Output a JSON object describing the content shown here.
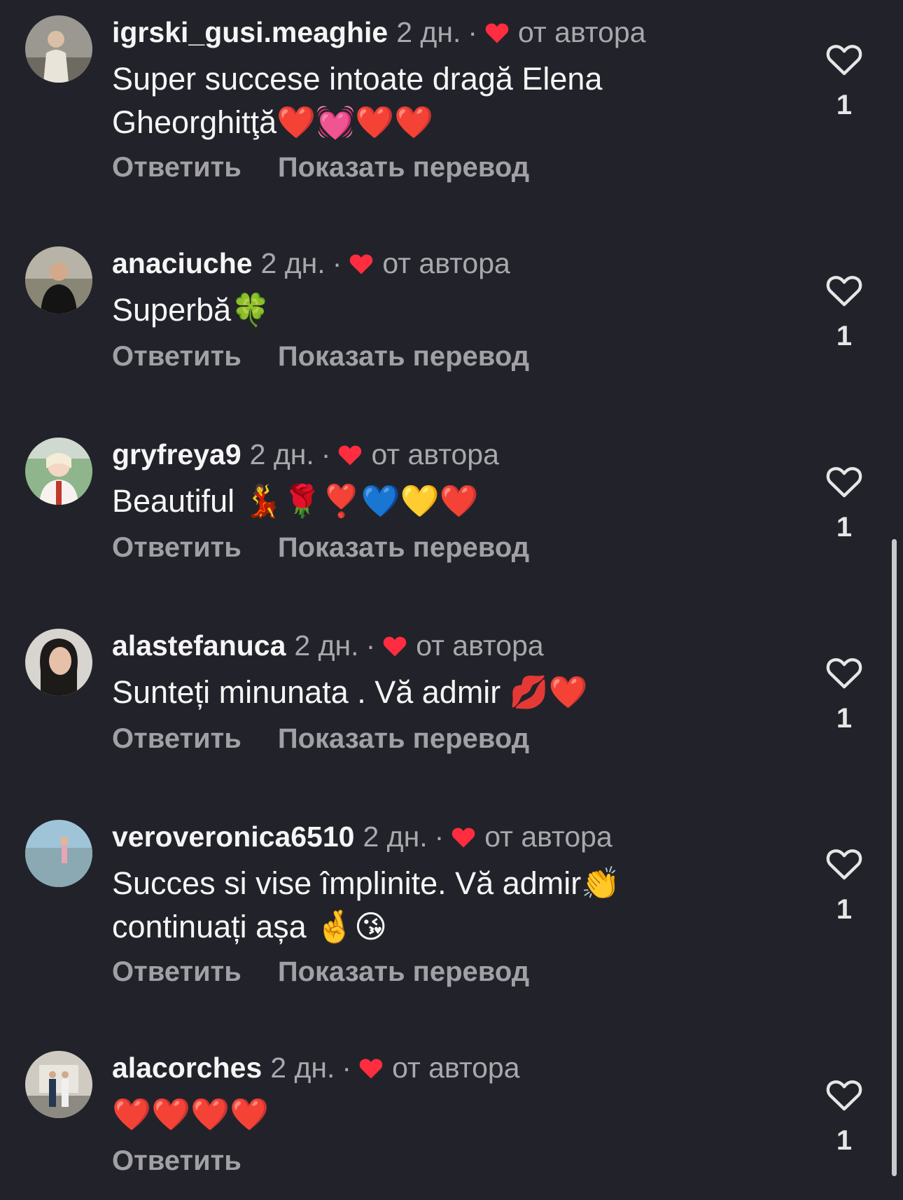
{
  "actions": {
    "reply_label": "Ответить",
    "translate_label": "Показать перевод"
  },
  "colors": {
    "background": "#22232a",
    "author_heart": "#ff2d3f",
    "secondary_text": "#a8a8ad"
  },
  "comments": [
    {
      "username": "igrski_gusi.meaghie",
      "time": "2 дн.",
      "author_label": "от автора",
      "text": "Super succese intoate dragă Elena Gheorghitţă❤️💓❤️❤️",
      "like_count": "1",
      "has_translate": true
    },
    {
      "username": "anaciuche",
      "time": "2 дн.",
      "author_label": "от автора",
      "text": "Superbă🍀",
      "like_count": "1",
      "has_translate": true
    },
    {
      "username": "gryfreya9",
      "time": "2 дн.",
      "author_label": "от автора",
      "text": "Beautiful 💃🌹❣️💙💛❤️",
      "like_count": "1",
      "has_translate": true
    },
    {
      "username": "alastefanuca",
      "time": "2 дн.",
      "author_label": "от автора",
      "text": "Sunteți minunata . Vă admir 💋❤️",
      "like_count": "1",
      "has_translate": true
    },
    {
      "username": "veroveronica6510",
      "time": "2 дн.",
      "author_label": "от автора",
      "text": "Succes si vise împlinite. Vă admir👏 continuați așa 🤞😘",
      "like_count": "1",
      "has_translate": true
    },
    {
      "username": "alacorches",
      "time": "2 дн.",
      "author_label": "от автора",
      "text": "❤️❤️❤️❤️",
      "like_count": "1",
      "has_translate": false
    }
  ]
}
